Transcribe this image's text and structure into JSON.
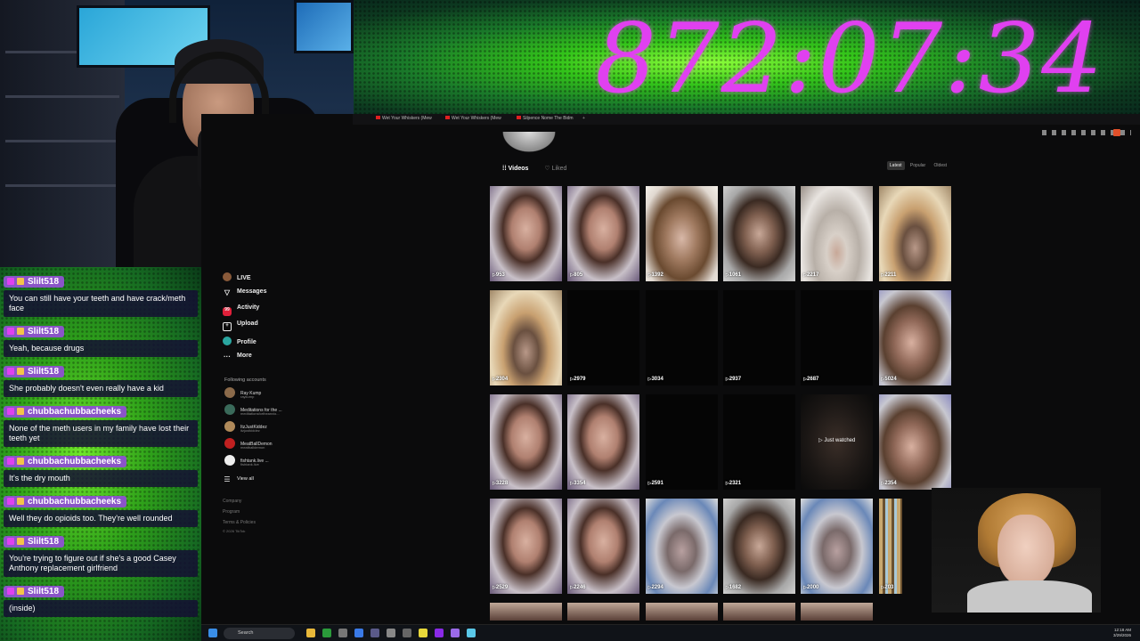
{
  "timer": "872:07:34",
  "browser_tabs": [
    "Wet Your Whiskers (Mew",
    "Wet Your Whiskers (Mew",
    "Silpence Nome The Bidm"
  ],
  "sidebar": {
    "items": [
      {
        "icon": "live-icon",
        "label": "LIVE"
      },
      {
        "icon": "messages-icon",
        "label": "Messages"
      },
      {
        "icon": "activity-icon",
        "label": "Activity",
        "badge": "99"
      },
      {
        "icon": "upload-icon",
        "label": "Upload"
      },
      {
        "icon": "profile-icon",
        "label": "Profile"
      },
      {
        "icon": "more-icon",
        "label": "More"
      }
    ],
    "following_header": "Following accounts",
    "accounts": [
      {
        "name": "Ray Kump",
        "handle": "raykump",
        "color": "#8b6a4a"
      },
      {
        "name": "Meditations for the ...",
        "handle": "meditationsfortheanxio...",
        "color": "#3a6a5a"
      },
      {
        "name": "ItzJustKiddez",
        "handle": "itzjustkiddez",
        "color": "#b08a5a"
      },
      {
        "name": "MeatBallDemon",
        "handle": "meatballdemon",
        "color": "#c02020"
      },
      {
        "name": "fishtank.live ...",
        "handle": "fishtank.live",
        "color": "#eeeeee"
      }
    ],
    "view_all": "View all",
    "footer": [
      "Company",
      "Program",
      "Terms & Policies",
      "© 2026 TikTok"
    ]
  },
  "profile_tabs": {
    "videos": "Videos",
    "liked": "Liked"
  },
  "sort": {
    "latest": "Latest",
    "popular": "Popular",
    "oldest": "Oldest"
  },
  "videos": [
    {
      "views": "953",
      "thumb": "face1"
    },
    {
      "views": "805",
      "thumb": "face1"
    },
    {
      "views": "1392",
      "thumb": "face2"
    },
    {
      "views": "1061",
      "thumb": "face3"
    },
    {
      "views": "2217",
      "thumb": "hood1"
    },
    {
      "views": "2211",
      "thumb": "hood2"
    },
    {
      "views": "2304",
      "thumb": "hood2"
    },
    {
      "views": "2979",
      "thumb": "dark"
    },
    {
      "views": "3034",
      "thumb": "dark"
    },
    {
      "views": "2937",
      "thumb": "dark"
    },
    {
      "views": "2687",
      "thumb": "dark"
    },
    {
      "views": "5024",
      "thumb": "face4"
    },
    {
      "views": "3228",
      "thumb": "face1"
    },
    {
      "views": "3354",
      "thumb": "face1"
    },
    {
      "views": "2591",
      "thumb": "dark"
    },
    {
      "views": "2321",
      "thumb": "dark"
    },
    {
      "views": "",
      "thumb": "watched",
      "label": "Just watched"
    },
    {
      "views": "2354",
      "thumb": "face4"
    },
    {
      "views": "2529",
      "thumb": "face1"
    },
    {
      "views": "2246",
      "thumb": "face1"
    },
    {
      "views": "2294",
      "thumb": "hood3"
    },
    {
      "views": "1682",
      "thumb": "face3"
    },
    {
      "views": "2000",
      "thumb": "hood3"
    },
    {
      "views": "203",
      "thumb": "shelf"
    }
  ],
  "chat": [
    {
      "user": "Slilt518",
      "text": "You can still have your teeth and have crack/meth face"
    },
    {
      "user": "Slilt518",
      "text": "Yeah, because drugs"
    },
    {
      "user": "Slilt518",
      "text": "She probably doesn't even really have a kid"
    },
    {
      "user": "chubbachubbacheeks",
      "text": "None of the meth users in my family have lost their teeth yet"
    },
    {
      "user": "chubbachubbacheeks",
      "text": "It's the dry mouth"
    },
    {
      "user": "chubbachubbacheeks",
      "text": "Well they do opioids too. They're well rounded"
    },
    {
      "user": "Slilt518",
      "text": "You're trying to figure out if she's a good Casey Anthony replacement girlfriend"
    },
    {
      "user": "Slilt518",
      "text": "(inside)"
    }
  ],
  "taskbar": {
    "search": "Search",
    "time": "12:18 AM",
    "date": "3/29/2026"
  }
}
